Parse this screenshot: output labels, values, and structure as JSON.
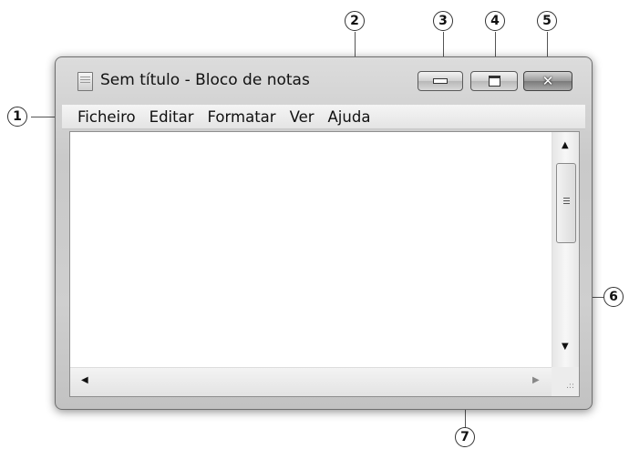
{
  "window": {
    "title": "Sem título - Bloco de notas",
    "app_icon": "notepad-icon"
  },
  "controls": {
    "min_icon": "minimize-icon",
    "max_icon": "maximize-icon",
    "close_icon": "close-icon",
    "close_glyph": "✕"
  },
  "menu": {
    "items": [
      "Ficheiro",
      "Editar",
      "Formatar",
      "Ver",
      "Ajuda"
    ]
  },
  "scrollbars": {
    "up_arrow": "▲",
    "down_arrow": "▼",
    "left_arrow": "◀",
    "right_arrow": "▶",
    "grip": ".::"
  },
  "callouts": [
    "1",
    "2",
    "3",
    "4",
    "5",
    "6",
    "7"
  ]
}
